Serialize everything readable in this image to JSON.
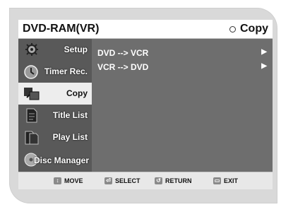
{
  "header": {
    "title": "DVD-RAM(VR)",
    "mode": "Copy"
  },
  "sidebar": {
    "items": [
      {
        "label": "Setup",
        "icon": "gear-icon",
        "active": false
      },
      {
        "label": "Timer Rec.",
        "icon": "clock-icon",
        "active": false
      },
      {
        "label": "Copy",
        "icon": "copy-icon",
        "active": true
      },
      {
        "label": "Title List",
        "icon": "document-icon",
        "active": false
      },
      {
        "label": "Play List",
        "icon": "playlist-icon",
        "active": false
      },
      {
        "label": "Disc Manager",
        "icon": "disc-icon",
        "active": false
      }
    ]
  },
  "menu": {
    "items": [
      {
        "label": "DVD --> VCR",
        "arrow": "▶"
      },
      {
        "label": "VCR --> DVD",
        "arrow": "▶"
      }
    ]
  },
  "footer": {
    "move": "MOVE",
    "select": "SELECT",
    "return": "RETURN",
    "exit": "EXIT"
  }
}
